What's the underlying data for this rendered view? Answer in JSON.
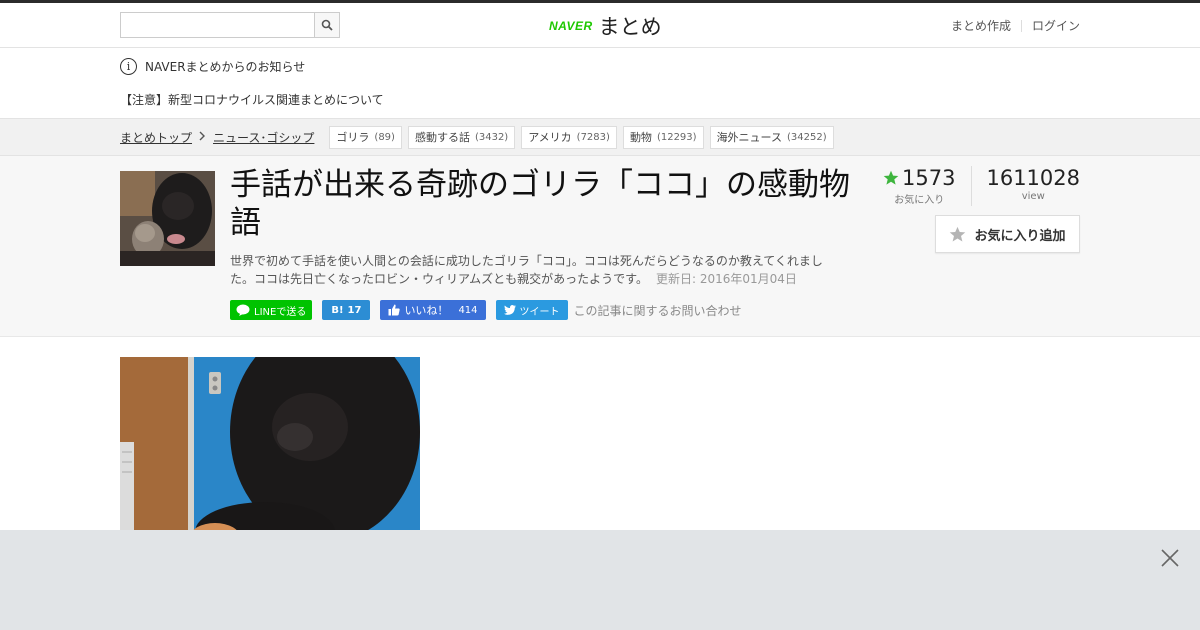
{
  "header": {
    "search_placeholder": "",
    "logo_naver": "NAVER",
    "logo_matome": "まとめ",
    "create_link": "まとめ作成",
    "login_link": "ログイン"
  },
  "notice": {
    "title": "NAVERまとめからのお知らせ",
    "link": "【注意】新型コロナウイルス関連まとめについて"
  },
  "breadcrumb": {
    "items": [
      "まとめトップ",
      "ニュース･ゴシップ"
    ],
    "tags": [
      {
        "label": "ゴリラ",
        "count": "(89)"
      },
      {
        "label": "感動する話",
        "count": "(3432)"
      },
      {
        "label": "アメリカ",
        "count": "(7283)"
      },
      {
        "label": "動物",
        "count": "(12293)"
      },
      {
        "label": "海外ニュース",
        "count": "(34252)"
      }
    ]
  },
  "article": {
    "title": "手話が出来る奇跡のゴリラ「ココ」の感動物語",
    "description": "世界で初めて手話を使い人間との会話に成功したゴリラ「ココ」。ココは死んだらどうなるのか教えてくれました。ココは先日亡くなったロビン・ウィリアムズとも親交があったようです。",
    "updated": "更新日: 2016年01月04日"
  },
  "share": {
    "line": "LINEで送る",
    "hatena_icon": "B!",
    "hatena_count": "17",
    "fb_label": "いいね！",
    "fb_count": "414",
    "tweet": "ツイート",
    "contact": "この記事に関するお問い合わせ"
  },
  "stats": {
    "fav_count": "1573",
    "fav_label": "お気に入り",
    "view_count": "1611028",
    "view_label": "view",
    "fav_button": "お気に入り追加"
  },
  "colors": {
    "naver_green": "#1ec800",
    "star_green": "#3eb53e",
    "ad_bar": "#e1e4e7"
  },
  "icons": [
    "search-icon",
    "info-icon",
    "chevron-right-icon",
    "star-icon",
    "line-icon",
    "facebook-like-icon",
    "twitter-bird-icon",
    "close-icon"
  ]
}
